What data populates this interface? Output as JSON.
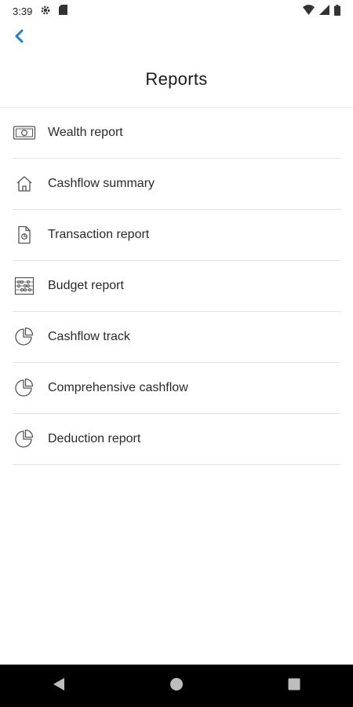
{
  "status_bar": {
    "time": "3:39",
    "icons": [
      "gear-icon",
      "sd-card-icon",
      "wifi-icon",
      "signal-icon",
      "battery-icon"
    ]
  },
  "header": {
    "back_icon": "chevron-left-icon",
    "title": "Reports"
  },
  "reports": {
    "items": [
      {
        "label": "Wealth report",
        "icon": "cash-icon"
      },
      {
        "label": "Cashflow summary",
        "icon": "house-icon"
      },
      {
        "label": "Transaction report",
        "icon": "document-icon"
      },
      {
        "label": "Budget report",
        "icon": "abacus-icon"
      },
      {
        "label": "Cashflow track",
        "icon": "pie-chart-icon"
      },
      {
        "label": "Comprehensive cashflow",
        "icon": "pie-chart-icon"
      },
      {
        "label": "Deduction report",
        "icon": "pie-chart-icon"
      }
    ]
  },
  "nav_bar": {
    "buttons": [
      "back-triangle-icon",
      "home-circle-icon",
      "recents-square-icon"
    ]
  },
  "colors": {
    "accent": "#1a7fd4",
    "divider": "#e3e3e3",
    "icon_stroke": "#555555"
  }
}
